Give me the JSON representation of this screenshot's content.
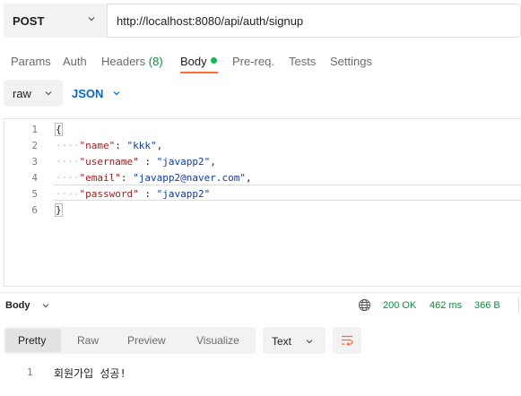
{
  "request": {
    "method": "POST",
    "url": "http://localhost:8080/api/auth/signup"
  },
  "tabs": {
    "params": "Params",
    "auth": "Auth",
    "headers": "Headers",
    "headers_count": "(8)",
    "body": "Body",
    "prereq": "Pre-req.",
    "tests": "Tests",
    "settings": "Settings"
  },
  "body_mode": {
    "type": "raw",
    "format": "JSON"
  },
  "editor": {
    "line_numbers": [
      "1",
      "2",
      "3",
      "4",
      "5",
      "6"
    ],
    "open_brace": "{",
    "close_brace": "}",
    "lines": [
      {
        "indent": "····",
        "key": "\"name\"",
        "sep": ": ",
        "value": "\"kkk\"",
        "end": ","
      },
      {
        "indent": "····",
        "key": "\"username\"",
        "sep": " : ",
        "value": "\"javapp2\"",
        "end": ","
      },
      {
        "indent": "····",
        "key": "\"email\"",
        "sep": ": ",
        "value": "\"javapp2@naver.com\"",
        "end": ","
      },
      {
        "indent": "····",
        "key": "\"password\"",
        "sep": " : ",
        "value": "\"javapp2\"",
        "end": ""
      }
    ]
  },
  "response": {
    "label": "Body",
    "status": "200 OK",
    "time": "462 ms",
    "size": "366 B",
    "view_tabs": [
      "Pretty",
      "Raw",
      "Preview",
      "Visualize"
    ],
    "active_view": "Pretty",
    "text_format": "Text",
    "line_number": "1",
    "content": "회원가입 성공!"
  },
  "colors": {
    "accent": "#ff6c37",
    "success": "#0a8d3c",
    "link": "#0265d2"
  }
}
